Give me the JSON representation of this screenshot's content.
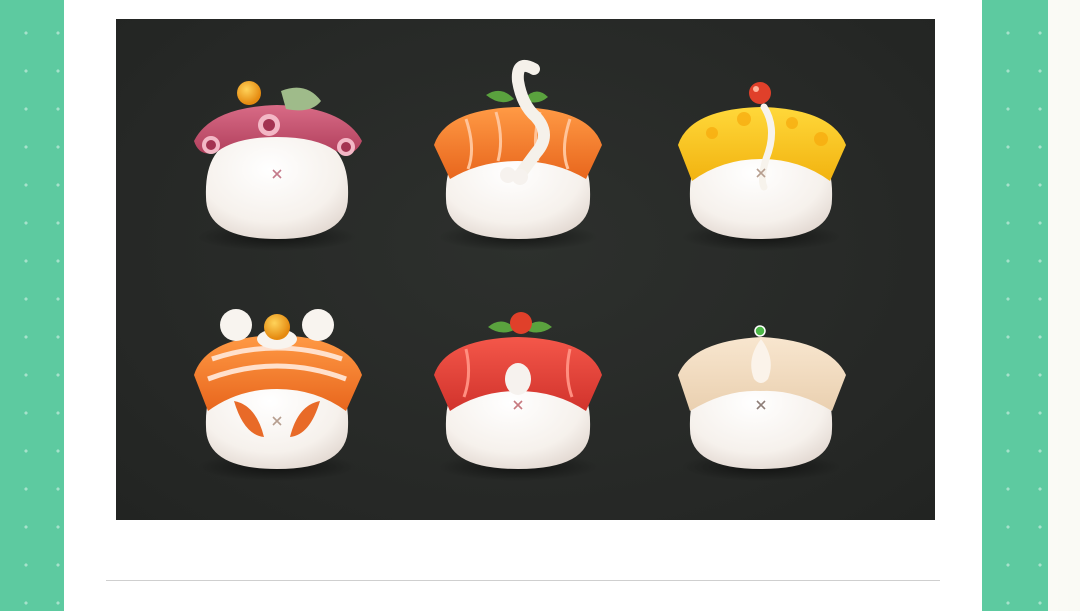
{
  "page": {
    "background_color": "#ffffff",
    "side_panel_color": "#5dcaa0",
    "artwork_background": "#262826"
  },
  "illustration": {
    "items": [
      {
        "name": "octopus-sushi",
        "topping_color": "#c2506e"
      },
      {
        "name": "salmon-sushi",
        "topping_color": "#f07a2a"
      },
      {
        "name": "tamago-sushi",
        "topping_color": "#f5c21a"
      },
      {
        "name": "salmon-roe-sushi",
        "topping_color": "#f07a3a"
      },
      {
        "name": "tuna-sushi",
        "topping_color": "#e5453a"
      },
      {
        "name": "scallop-sushi",
        "topping_color": "#f3dcc0"
      }
    ]
  }
}
